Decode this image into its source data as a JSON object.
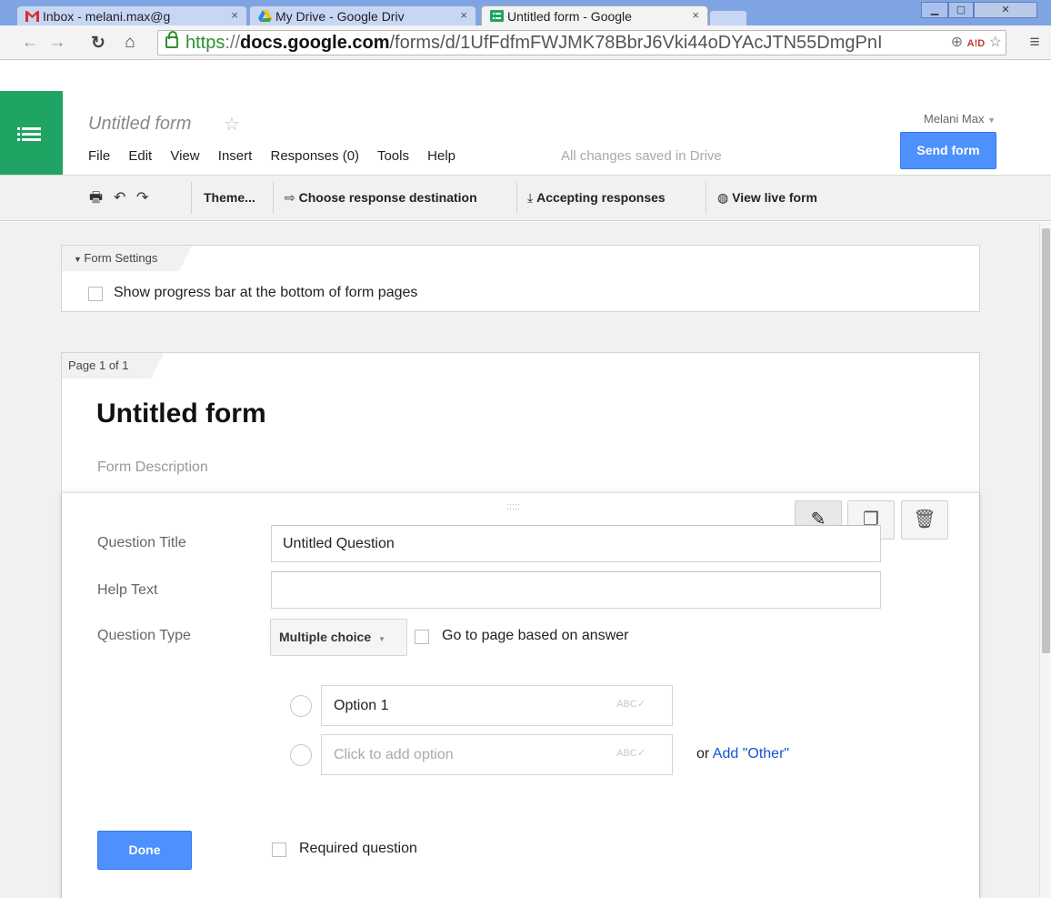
{
  "browser": {
    "tabs": [
      {
        "title": "Inbox - melani.max@g",
        "icon": "gmail-icon"
      },
      {
        "title": "My Drive - Google Driv",
        "icon": "drive-icon"
      },
      {
        "title": "Untitled form - Google",
        "icon": "forms-icon",
        "active": true
      }
    ],
    "close_glyph": "×",
    "url": {
      "scheme": "https",
      "separator": "://",
      "host": "docs.google.com",
      "path": "/forms/d/1UfFdfmFWJMK78BbrJ6Vki44oDYAcJTN55DmgPnI"
    },
    "window_controls": [
      "minimize",
      "maximize",
      "close"
    ]
  },
  "app": {
    "doc_title": "Untitled form",
    "star": "☆",
    "menu": [
      "File",
      "Edit",
      "View",
      "Insert",
      "Responses (0)",
      "Tools",
      "Help"
    ],
    "save_status": "All changes saved in Drive",
    "user": "Melani Max",
    "send_button": "Send form"
  },
  "toolbar": {
    "theme": "Theme...",
    "response_dest": "Choose response destination",
    "accepting": "Accepting responses",
    "live_form": "View live form"
  },
  "settings": {
    "header": "Form Settings",
    "progress_label": "Show progress bar at the bottom of form pages"
  },
  "page": {
    "label": "Page 1 of 1",
    "form_title": "Untitled form",
    "form_description": "Form Description"
  },
  "question": {
    "title_label": "Question Title",
    "title_value": "Untitled Question",
    "help_label": "Help Text",
    "help_value": "",
    "type_label": "Question Type",
    "type_value": "Multiple choice",
    "goto_label": "Go to page based on answer",
    "options": [
      {
        "value": "Option 1"
      }
    ],
    "add_option_placeholder": "Click to add option",
    "or_text": "or",
    "add_other": "Add \"Other\"",
    "done_button": "Done",
    "required_label": "Required question",
    "spellcheck_glyph": "ABC✓",
    "drag_handle": ":::::"
  },
  "colors": {
    "accent_blue": "#4d90fe",
    "forms_green": "#1fa463",
    "link_blue": "#1155cc",
    "secure_green": "#2f8f2f"
  }
}
